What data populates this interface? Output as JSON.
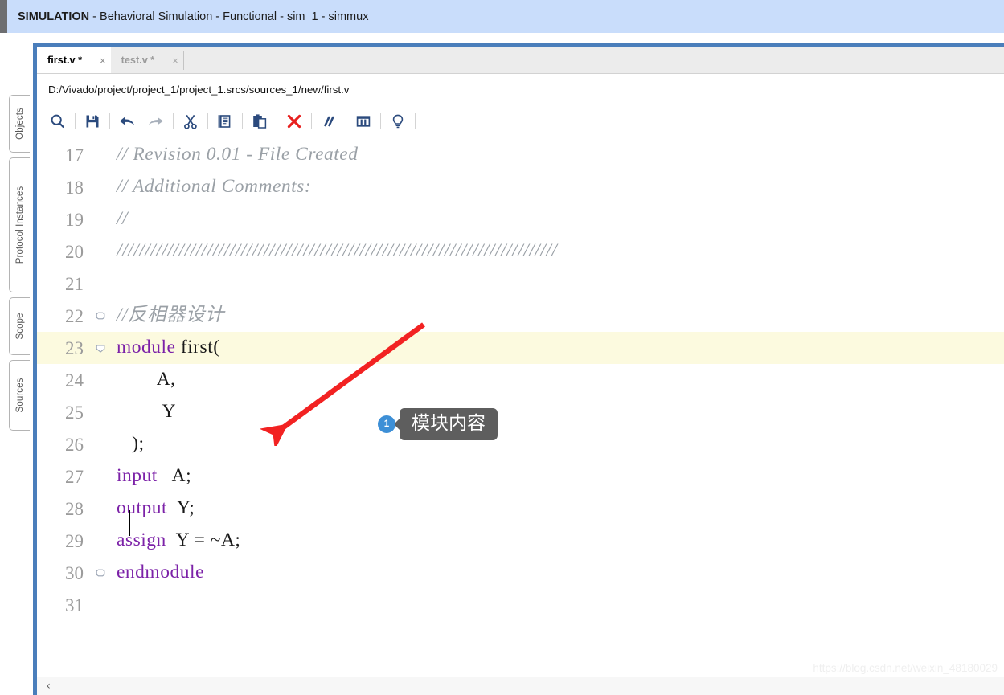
{
  "header": {
    "title_strong": "SIMULATION",
    "title_rest": " - Behavioral Simulation - Functional - sim_1 - simmux",
    "accent_color": "#6d6e71",
    "background_color": "#c9ddfb"
  },
  "left_tabs": [
    {
      "label": "Objects"
    },
    {
      "label": "Protocol Instances"
    },
    {
      "label": "Scope"
    },
    {
      "label": "Sources"
    }
  ],
  "editor": {
    "accent_color": "#4a7ebb",
    "tabs": [
      {
        "label": "first.v *",
        "close": "×",
        "active": true
      },
      {
        "label": "test.v *",
        "close": "×",
        "active": false
      }
    ],
    "file_path": "D:/Vivado/project/project_1/project_1.srcs/sources_1/new/first.v",
    "toolbar": [
      {
        "name": "search-icon",
        "title": "Find"
      },
      {
        "name": "save-icon",
        "title": "Save File"
      },
      {
        "name": "undo-icon",
        "title": "Undo"
      },
      {
        "name": "redo-icon",
        "title": "Redo"
      },
      {
        "name": "cut-icon",
        "title": "Cut"
      },
      {
        "name": "copy-icon",
        "title": "Copy"
      },
      {
        "name": "paste-icon",
        "title": "Paste"
      },
      {
        "name": "delete-icon",
        "title": "Delete"
      },
      {
        "name": "comment-icon",
        "title": "Toggle Comment"
      },
      {
        "name": "columns-icon",
        "title": "Column Edit"
      },
      {
        "name": "bulb-icon",
        "title": "Hints"
      }
    ],
    "keyword_color": "#7c22a8",
    "comment_color": "#9aa0a6",
    "highlight_color": "#fcfadf",
    "lines": [
      {
        "no": "17",
        "fold": "none",
        "highlight": false,
        "tokens": [
          {
            "t": "comment",
            "s": "// Revision 0.01 - File Created"
          }
        ]
      },
      {
        "no": "18",
        "fold": "none",
        "highlight": false,
        "tokens": [
          {
            "t": "comment",
            "s": "// Additional Comments:"
          }
        ]
      },
      {
        "no": "19",
        "fold": "none",
        "highlight": false,
        "tokens": [
          {
            "t": "comment",
            "s": "//"
          }
        ]
      },
      {
        "no": "20",
        "fold": "none",
        "highlight": false,
        "tokens": [
          {
            "t": "comment",
            "s": "//////////////////////////////////////////////////////////////////////////////"
          }
        ]
      },
      {
        "no": "21",
        "fold": "none",
        "highlight": false,
        "tokens": [
          {
            "t": "plain",
            "s": ""
          }
        ]
      },
      {
        "no": "22",
        "fold": "open",
        "highlight": false,
        "tokens": [
          {
            "t": "comment",
            "s": "//反相器设计"
          }
        ]
      },
      {
        "no": "23",
        "fold": "open",
        "highlight": true,
        "tokens": [
          {
            "t": "kw",
            "s": "module"
          },
          {
            "t": "plain",
            "s": " first("
          }
        ]
      },
      {
        "no": "24",
        "fold": "none",
        "highlight": false,
        "tokens": [
          {
            "t": "plain",
            "s": "        A,"
          }
        ]
      },
      {
        "no": "25",
        "fold": "none",
        "highlight": false,
        "tokens": [
          {
            "t": "plain",
            "s": "         Y"
          }
        ]
      },
      {
        "no": "26",
        "fold": "none",
        "highlight": false,
        "tokens": [
          {
            "t": "plain",
            "s": "   );"
          }
        ]
      },
      {
        "no": "27",
        "fold": "none",
        "highlight": false,
        "tokens": [
          {
            "t": "kw",
            "s": "input"
          },
          {
            "t": "plain",
            "s": "   A;"
          }
        ]
      },
      {
        "no": "28",
        "fold": "none",
        "highlight": false,
        "tokens": [
          {
            "t": "kw",
            "s": "output"
          },
          {
            "t": "plain",
            "s": "  Y;"
          }
        ]
      },
      {
        "no": "29",
        "fold": "none",
        "highlight": false,
        "tokens": [
          {
            "t": "kw",
            "s": "assign"
          },
          {
            "t": "plain",
            "s": "  Y = ~A;"
          }
        ]
      },
      {
        "no": "30",
        "fold": "open",
        "highlight": false,
        "tokens": [
          {
            "t": "kw",
            "s": "endmodule"
          }
        ]
      },
      {
        "no": "31",
        "fold": "none",
        "highlight": false,
        "tokens": [
          {
            "t": "plain",
            "s": ""
          }
        ]
      }
    ]
  },
  "annotation": {
    "badge": "1",
    "label": "模块内容",
    "arrow_color": "#f22222",
    "badge_color": "#3d8fd6",
    "bubble_color": "#5e5e5e"
  },
  "bottom": {
    "scroll_left": "‹"
  },
  "watermark": "https://blog.csdn.net/weixin_48180029"
}
